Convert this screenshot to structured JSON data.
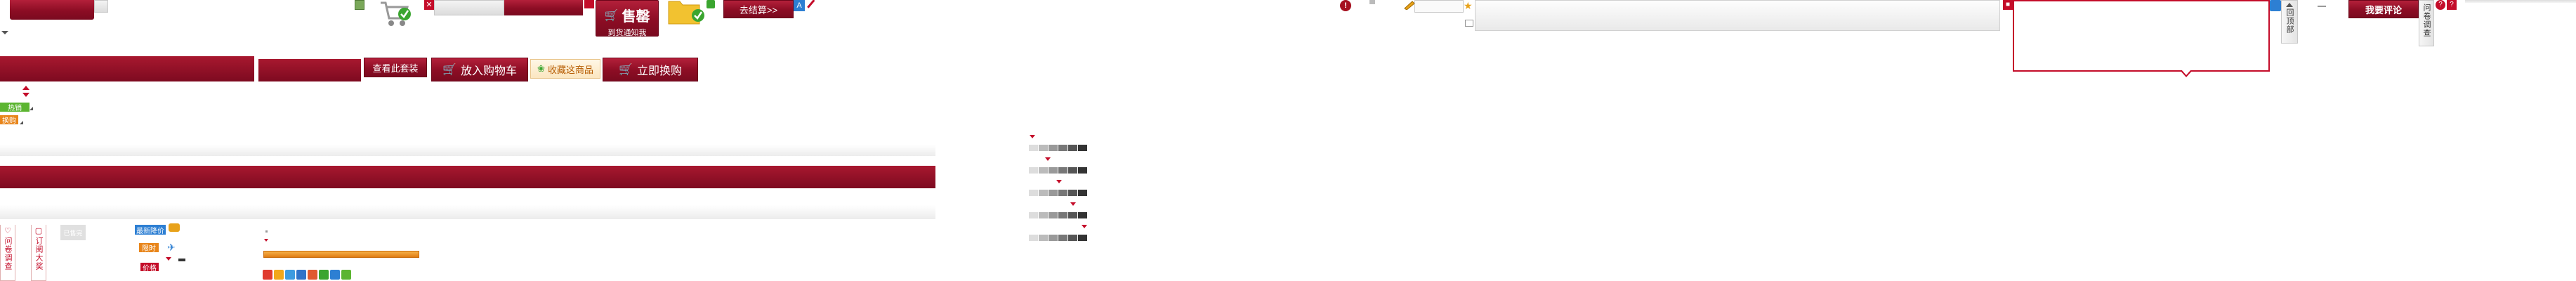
{
  "sale_banner": {
    "title": "售罄",
    "subtitle": "到货通知我"
  },
  "checkout_button": {
    "label": "去结算>>"
  },
  "buttons": {
    "view_package": "查看此套装",
    "add_to_cart": "放入购物车",
    "favorites": "收藏这商品",
    "buy_now": "立即换购"
  },
  "tags": {
    "tag_a": "换购",
    "tag_b": "限时"
  },
  "vertical_tabs": {
    "help_item_a": "问卷调查",
    "help_item_b": "订阅大奖"
  },
  "left_small_tags": {
    "new_badge": "热销",
    "grey_box": "已售完",
    "blue_badge": "最新降价",
    "price_tag": "价格"
  },
  "right_side": {
    "back_to_top": "回顶部",
    "survey": "问卷调查",
    "write_review": "我要评论"
  },
  "colors": {
    "brand_red": "#8c0d24",
    "accent_red": "#c40d2a",
    "orange": "#e8851a",
    "green": "#5cb531",
    "blue": "#2d7fd3"
  },
  "icons": [
    "cart-icon",
    "check-icon",
    "close-icon",
    "folder-icon",
    "star-icon",
    "pen-icon",
    "warning-icon",
    "plane-icon",
    "heart-icon",
    "social-icon"
  ]
}
